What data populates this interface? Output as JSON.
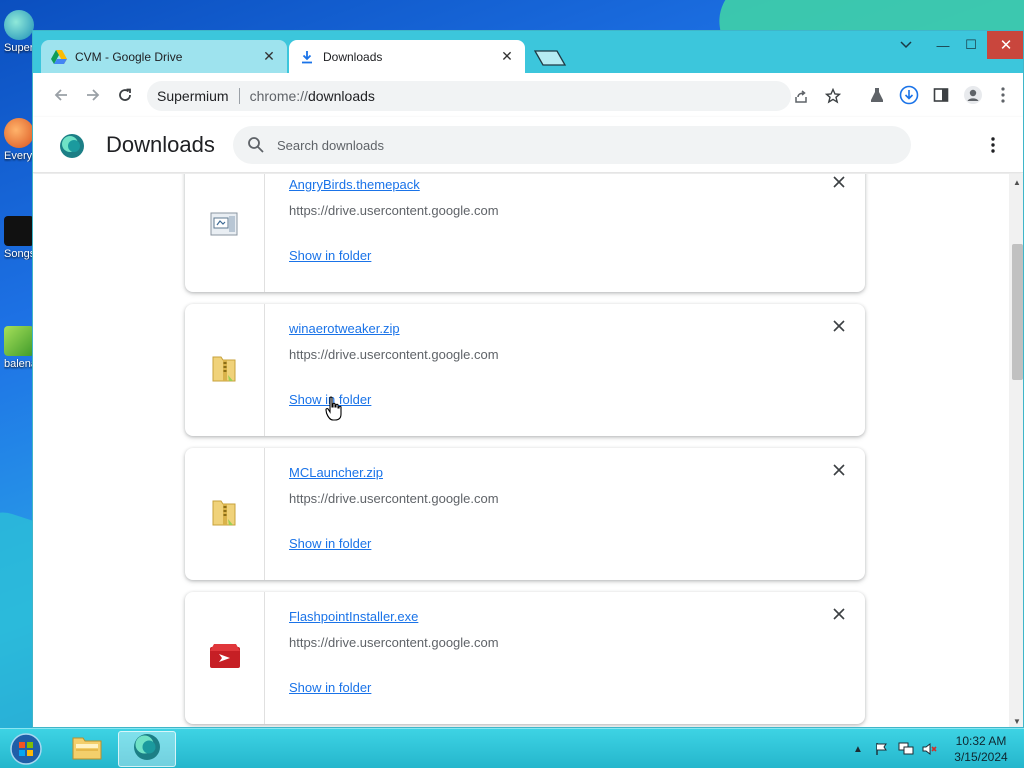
{
  "desktop": {
    "icons": [
      {
        "label": "Supermium",
        "color": "#2c9bd1"
      },
      {
        "label": "Everything",
        "color": "#e8642a"
      },
      {
        "label": "Songs",
        "color": "#222222"
      },
      {
        "label": "balena",
        "color": "#7bc043"
      }
    ]
  },
  "browser": {
    "tabs": [
      {
        "title": "CVM - Google Drive",
        "active": false
      },
      {
        "title": "Downloads",
        "active": true
      }
    ],
    "window_controls": {
      "minimize": "—",
      "maximize": "☐",
      "close": "✕"
    },
    "omnibox": {
      "site": "Supermium",
      "url_prefix": "chrome://",
      "url_host": "downloads"
    }
  },
  "page": {
    "title": "Downloads",
    "search_placeholder": "Search downloads"
  },
  "downloads": [
    {
      "file_name": "AngryBirds.themepack",
      "url": "https://drive.usercontent.google.com",
      "action": "Show in folder",
      "icon": "themepack-icon"
    },
    {
      "file_name": "winaerotweaker.zip",
      "url": "https://drive.usercontent.google.com",
      "action": "Show in folder",
      "icon": "zip-folder-icon"
    },
    {
      "file_name": "MCLauncher.zip",
      "url": "https://drive.usercontent.google.com",
      "action": "Show in folder",
      "icon": "zip-folder-icon"
    },
    {
      "file_name": "FlashpointInstaller.exe",
      "url": "https://drive.usercontent.google.com",
      "action": "Show in folder",
      "icon": "exe-icon"
    }
  ],
  "taskbar": {
    "time": "10:32 AM",
    "date": "3/15/2024"
  },
  "colors": {
    "accent": "#1a73e8",
    "titlebar": "#3cc6dc",
    "close": "#c9463d"
  }
}
